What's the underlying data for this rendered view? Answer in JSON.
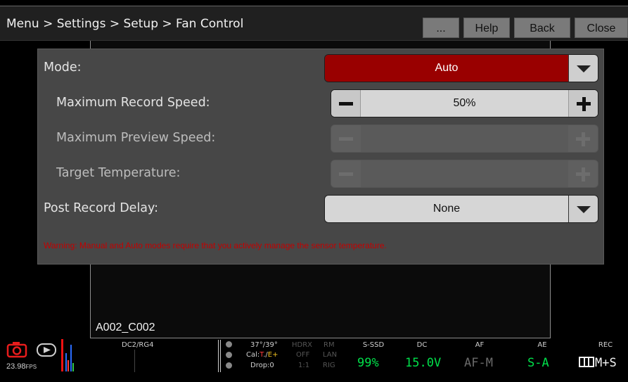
{
  "breadcrumb": "Menu > Settings > Setup > Fan Control",
  "toolbar": {
    "more_label": "...",
    "help_label": "Help",
    "back_label": "Back",
    "close_label": "Close"
  },
  "settings": {
    "mode": {
      "label": "Mode:",
      "value": "Auto",
      "color": "#990000"
    },
    "max_record_speed": {
      "label": "Maximum Record Speed:",
      "value": "50%"
    },
    "max_preview_speed": {
      "label": "Maximum Preview Speed:",
      "value": ""
    },
    "target_temperature": {
      "label": "Target Temperature:",
      "value": ""
    },
    "post_record_delay": {
      "label": "Post Record Delay:",
      "value": "None"
    }
  },
  "warning": "Warning: Manual and Auto modes require that you actively manage the sensor temperature.",
  "viewfinder": {
    "clip_name": "A002_C002"
  },
  "status": {
    "fps": "23.98",
    "fps_unit": "FPS",
    "codec": "DC2/RG4",
    "temp": "37°/39°",
    "cal_prefix": "Cal:",
    "cal_t": "T",
    "cal_sep": "./",
    "cal_e": "E+",
    "drop": "Drop:0",
    "hdrx": {
      "label": "HDRX",
      "value": "OFF",
      "ratio": "1:1"
    },
    "rm": {
      "label": "RM",
      "lan": "LAN",
      "rig": "RIG"
    },
    "media": {
      "label": "S-SSD",
      "value": "99%"
    },
    "power": {
      "label": "DC",
      "value": "15.0V"
    },
    "af": {
      "label": "AF",
      "value": "AF-M"
    },
    "ae": {
      "label": "AE",
      "value": "S-A"
    },
    "rec": {
      "label": "REC",
      "value": "M+S"
    },
    "colors": {
      "green": "#00e04a",
      "red": "#ff2222",
      "cal_t": "#ff3b3b",
      "cal_e": "#f0c020"
    }
  }
}
